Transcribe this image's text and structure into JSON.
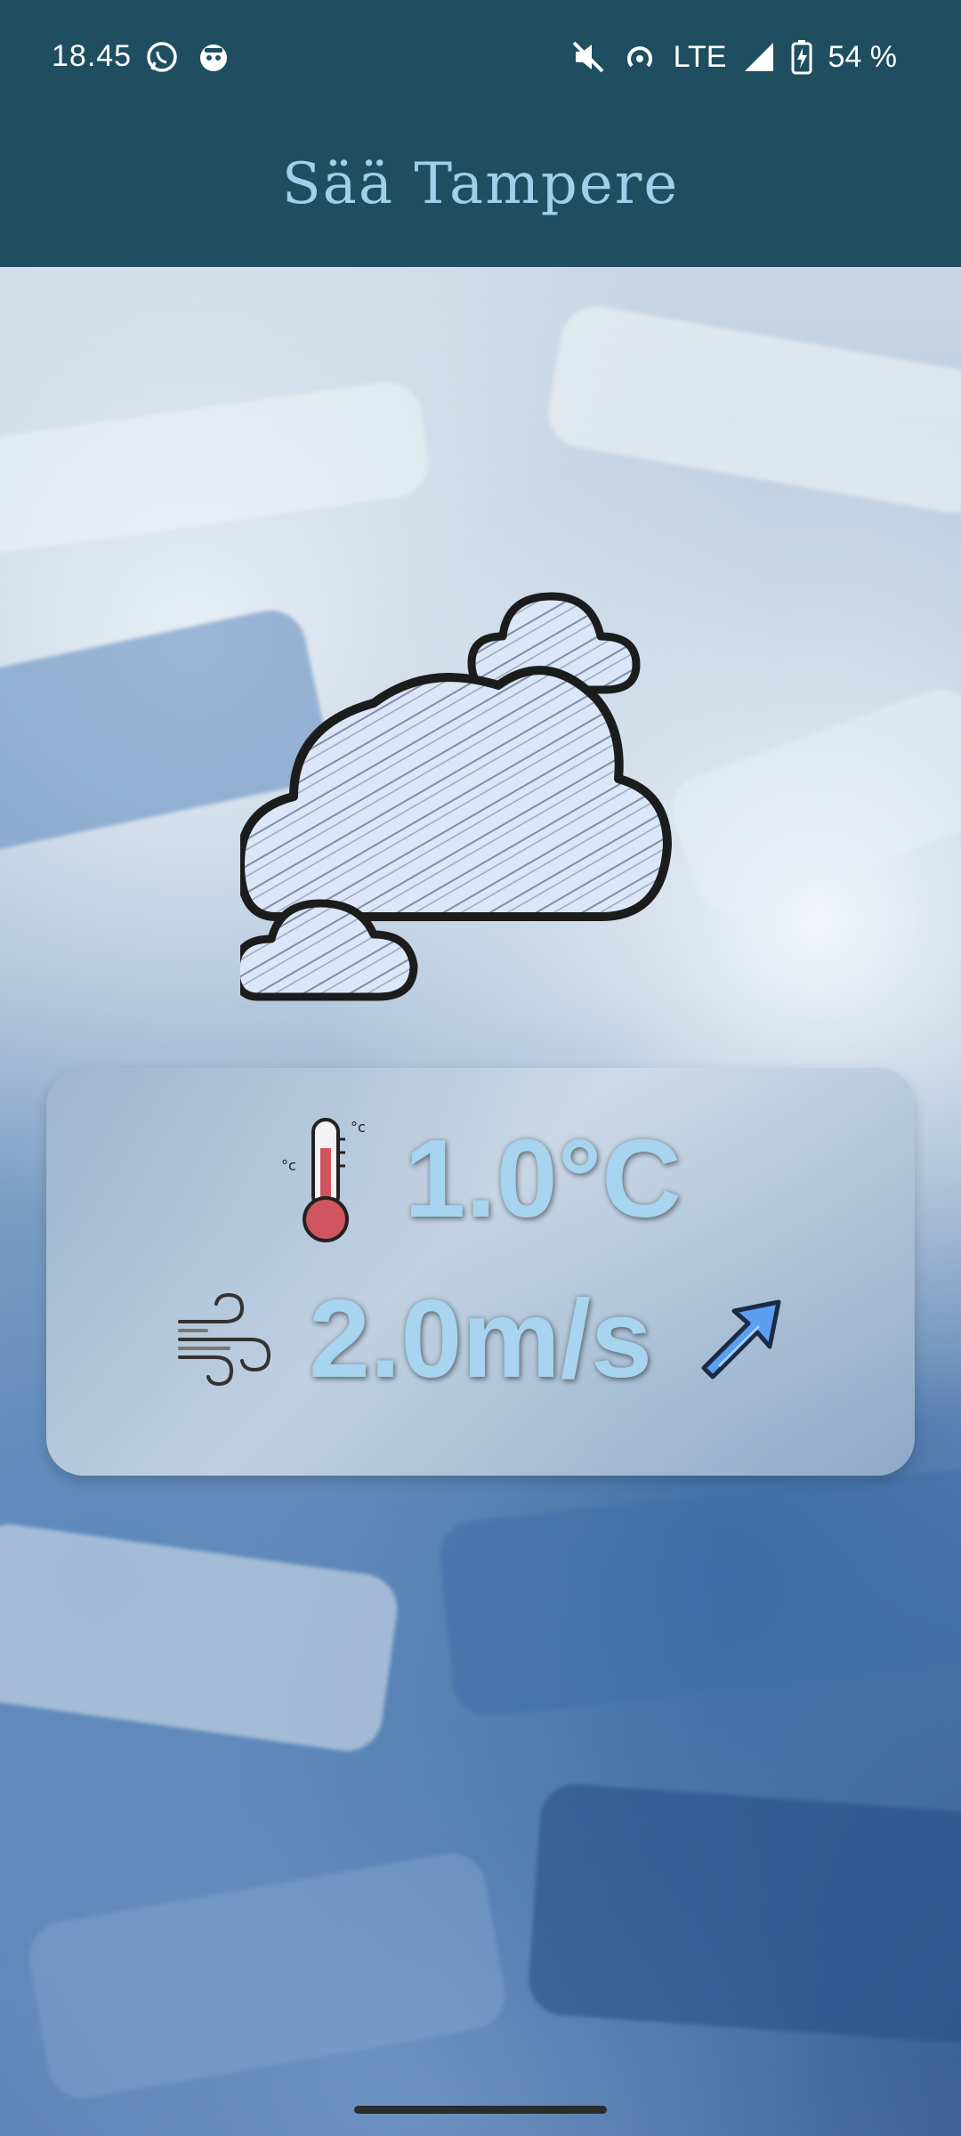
{
  "status_bar": {
    "time": "18.45",
    "network": "LTE",
    "battery": "54 %",
    "icons": [
      "whatsapp-icon",
      "app-notification-icon",
      "mute-icon",
      "hotspot-icon",
      "signal-icon",
      "battery-charging-icon"
    ]
  },
  "app_bar": {
    "title": "Sää Tampere"
  },
  "weather": {
    "condition_icon": "cloudy-icon",
    "temperature": "1.0°C",
    "wind_speed": "2.0m/s",
    "wind_direction_icon": "arrow-up-right-icon"
  },
  "colors": {
    "app_bar": "#1f4e61",
    "title": "#9fd0ea",
    "value_text": "#a7d4ee",
    "arrow": "#5b9ff0"
  }
}
